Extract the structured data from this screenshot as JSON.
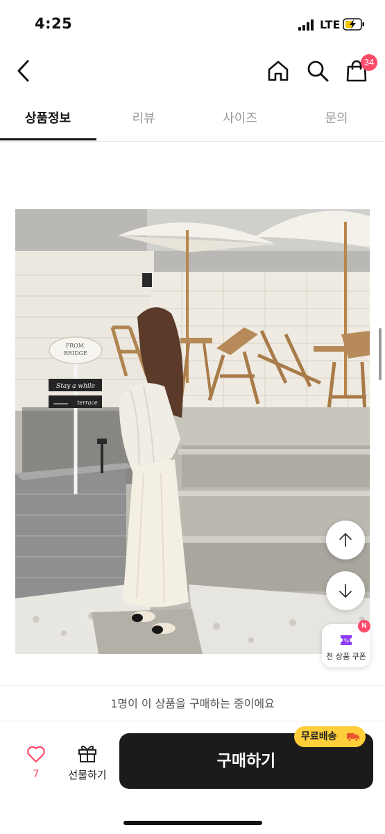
{
  "status_bar": {
    "time": "4:25",
    "network": "LTE"
  },
  "header": {
    "cart_count": "34"
  },
  "tabs": [
    {
      "label": "상품정보",
      "active": true
    },
    {
      "label": "리뷰",
      "active": false
    },
    {
      "label": "사이즈",
      "active": false
    },
    {
      "label": "문의",
      "active": false
    }
  ],
  "photo": {
    "signs": {
      "cafe_name_1": "FROM.",
      "cafe_name_2": "BRIDGE",
      "sign_1": "Stay a while",
      "sign_2": "terrace"
    }
  },
  "coupon": {
    "label": "전 상품 쿠폰",
    "badge": "N"
  },
  "buyer_notice": "1명이 이 상품을 구매하는 중이에요",
  "actions": {
    "like_count": "7",
    "gift_label": "선물하기",
    "buy_label": "구매하기",
    "shipping_badge": "무료배송"
  },
  "colors": {
    "accent": "#ff4b6b",
    "buy_button": "#1b1b1b",
    "shipping_badge": "#ffce3a"
  }
}
